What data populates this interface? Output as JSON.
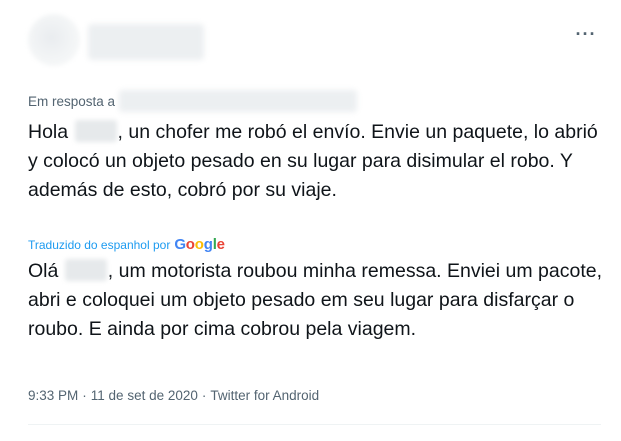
{
  "header": {
    "more_label": "···"
  },
  "reply": {
    "prefix": "Em resposta a"
  },
  "original_text": {
    "part1": "Hola",
    "part2": ", un chofer me robó el envío. Envie un paquete, lo abrió y colocó un objeto pesado en su lugar para disimular el robo. Y además de esto, cobró por su viaje."
  },
  "translation_notice": {
    "label": "Traduzido do espanhol por",
    "provider": "Google",
    "provider_letters": [
      "G",
      "o",
      "o",
      "g",
      "l",
      "e"
    ],
    "provider_colors": [
      "#4285f4",
      "#ea4335",
      "#fbbc05",
      "#4285f4",
      "#34a853",
      "#ea4335"
    ]
  },
  "translated_text": {
    "part1": "Olá",
    "part2": ", um motorista roubou minha remessa. Enviei um pacote, abri e coloquei um objeto pesado em seu lugar para disfarçar o roubo. E ainda por cima cobrou pela viagem."
  },
  "meta": {
    "time": "9:33 PM",
    "date": "11 de set de 2020",
    "source": "Twitter for Android",
    "separator": "·"
  }
}
